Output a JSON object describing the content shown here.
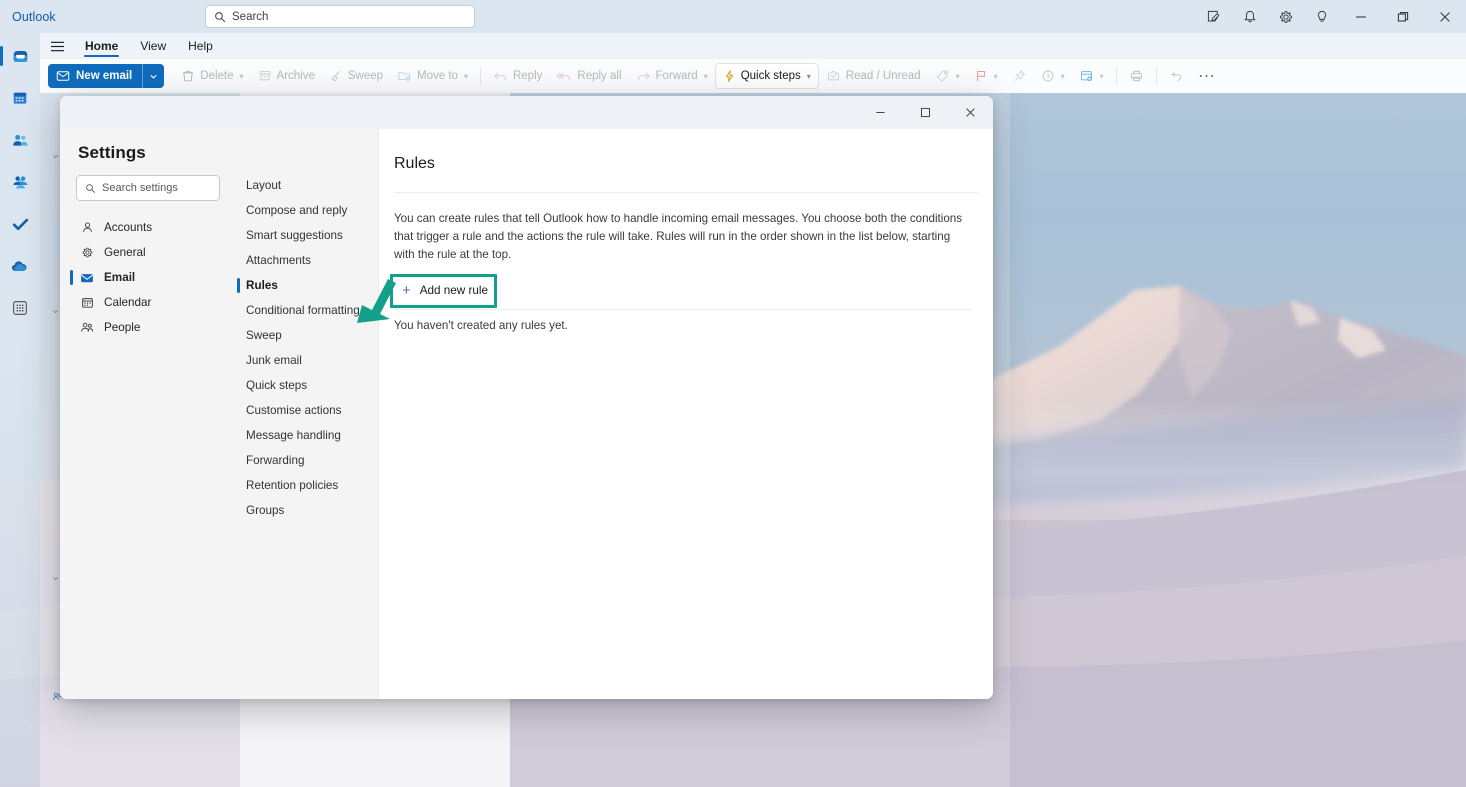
{
  "colors": {
    "accent": "#0f6cbd",
    "highlight": "#12a08a",
    "brand_text": "#0f5ca8",
    "newmail_bg": "#0f6cbd"
  },
  "titlebar": {
    "brand": "Outlook",
    "search": {
      "placeholder": "Search",
      "icon": "search-icon"
    },
    "icons": [
      {
        "name": "note-edit-icon",
        "glyph": "note"
      },
      {
        "name": "notification-bell-icon",
        "glyph": "bell"
      },
      {
        "name": "gear-icon",
        "glyph": "gear"
      },
      {
        "name": "lightbulb-icon",
        "glyph": "bulb"
      }
    ],
    "window_controls": [
      {
        "name": "minimize-button",
        "glyph": "minimize"
      },
      {
        "name": "maximize-button",
        "glyph": "restore"
      },
      {
        "name": "close-button",
        "glyph": "close"
      }
    ]
  },
  "rail": [
    {
      "name": "rail-mail",
      "label": "Mail",
      "active": true
    },
    {
      "name": "rail-calendar",
      "label": "Calendar",
      "active": false
    },
    {
      "name": "rail-people",
      "label": "People",
      "active": false
    },
    {
      "name": "rail-groups",
      "label": "Groups",
      "active": false
    },
    {
      "name": "rail-todo",
      "label": "To Do",
      "active": false
    },
    {
      "name": "rail-onedrive",
      "label": "OneDrive",
      "active": false
    },
    {
      "name": "rail-apps",
      "label": "Apps",
      "active": false
    }
  ],
  "ribbon": {
    "hamburger": "menu-icon",
    "tabs": [
      {
        "label": "Home",
        "active": true
      },
      {
        "label": "View",
        "active": false
      },
      {
        "label": "Help",
        "active": false
      }
    ]
  },
  "toolbar": {
    "new_email": "New email",
    "items": [
      {
        "label": "Delete",
        "icon": "trash-icon",
        "enabled": false,
        "caret": true
      },
      {
        "label": "Archive",
        "icon": "archive-icon",
        "enabled": false,
        "caret": false
      },
      {
        "label": "Sweep",
        "icon": "broom-icon",
        "enabled": false,
        "caret": false
      },
      {
        "label": "Move to",
        "icon": "folder-arrow-icon",
        "enabled": false,
        "caret": true
      },
      {
        "label": "Reply",
        "icon": "reply-icon",
        "enabled": false,
        "caret": false
      },
      {
        "label": "Reply all",
        "icon": "reply-all-icon",
        "enabled": false,
        "caret": false
      },
      {
        "label": "Forward",
        "icon": "forward-icon",
        "enabled": false,
        "caret": true
      },
      {
        "label": "Quick steps",
        "icon": "lightning-icon",
        "enabled": true,
        "caret": true,
        "boxed": true
      },
      {
        "label": "Read / Unread",
        "icon": "envelope-check-icon",
        "enabled": false,
        "caret": false
      }
    ],
    "icon_only": [
      {
        "name": "tag-icon",
        "caret": true
      },
      {
        "name": "flag-icon",
        "caret": true
      },
      {
        "name": "pin-icon",
        "caret": false
      },
      {
        "name": "snooze-clock-icon",
        "caret": true
      },
      {
        "name": "rules-icon",
        "caret": true
      },
      {
        "name": "print-icon",
        "caret": false
      },
      {
        "name": "undo-icon",
        "caret": false
      },
      {
        "name": "more-options-icon",
        "caret": false
      }
    ]
  },
  "dialog": {
    "window_controls": [
      {
        "name": "dialog-minimize-button",
        "glyph": "minimize"
      },
      {
        "name": "dialog-maximize-button",
        "glyph": "maximize"
      },
      {
        "name": "dialog-close-button",
        "glyph": "close"
      }
    ],
    "title": "Settings",
    "search": {
      "placeholder": "Search settings",
      "icon": "search-icon"
    },
    "nav": [
      {
        "label": "Accounts",
        "icon": "person-icon",
        "active": false
      },
      {
        "label": "General",
        "icon": "gear-icon",
        "active": false
      },
      {
        "label": "Email",
        "icon": "envelope-icon",
        "active": true
      },
      {
        "label": "Calendar",
        "icon": "calendar-icon",
        "active": false
      },
      {
        "label": "People",
        "icon": "people-icon",
        "active": false
      }
    ],
    "categories": [
      {
        "label": "Layout",
        "active": false
      },
      {
        "label": "Compose and reply",
        "active": false
      },
      {
        "label": "Smart suggestions",
        "active": false
      },
      {
        "label": "Attachments",
        "active": false
      },
      {
        "label": "Rules",
        "active": true
      },
      {
        "label": "Conditional formatting",
        "active": false
      },
      {
        "label": "Sweep",
        "active": false
      },
      {
        "label": "Junk email",
        "active": false
      },
      {
        "label": "Quick steps",
        "active": false
      },
      {
        "label": "Customise actions",
        "active": false
      },
      {
        "label": "Message handling",
        "active": false
      },
      {
        "label": "Forwarding",
        "active": false
      },
      {
        "label": "Retention policies",
        "active": false
      },
      {
        "label": "Groups",
        "active": false
      }
    ],
    "pane": {
      "title": "Rules",
      "description": "You can create rules that tell Outlook how to handle incoming email messages. You choose both the conditions that trigger a rule and the actions the rule will take. Rules will run in the order shown in the list below, starting with the rule at the top.",
      "add_rule_label": "Add new rule",
      "add_rule_icon": "plus-icon",
      "empty_message": "You haven't created any rules yet."
    }
  },
  "annotation": {
    "highlight_target": "Add new rule",
    "arrow_color": "#12a08a"
  }
}
